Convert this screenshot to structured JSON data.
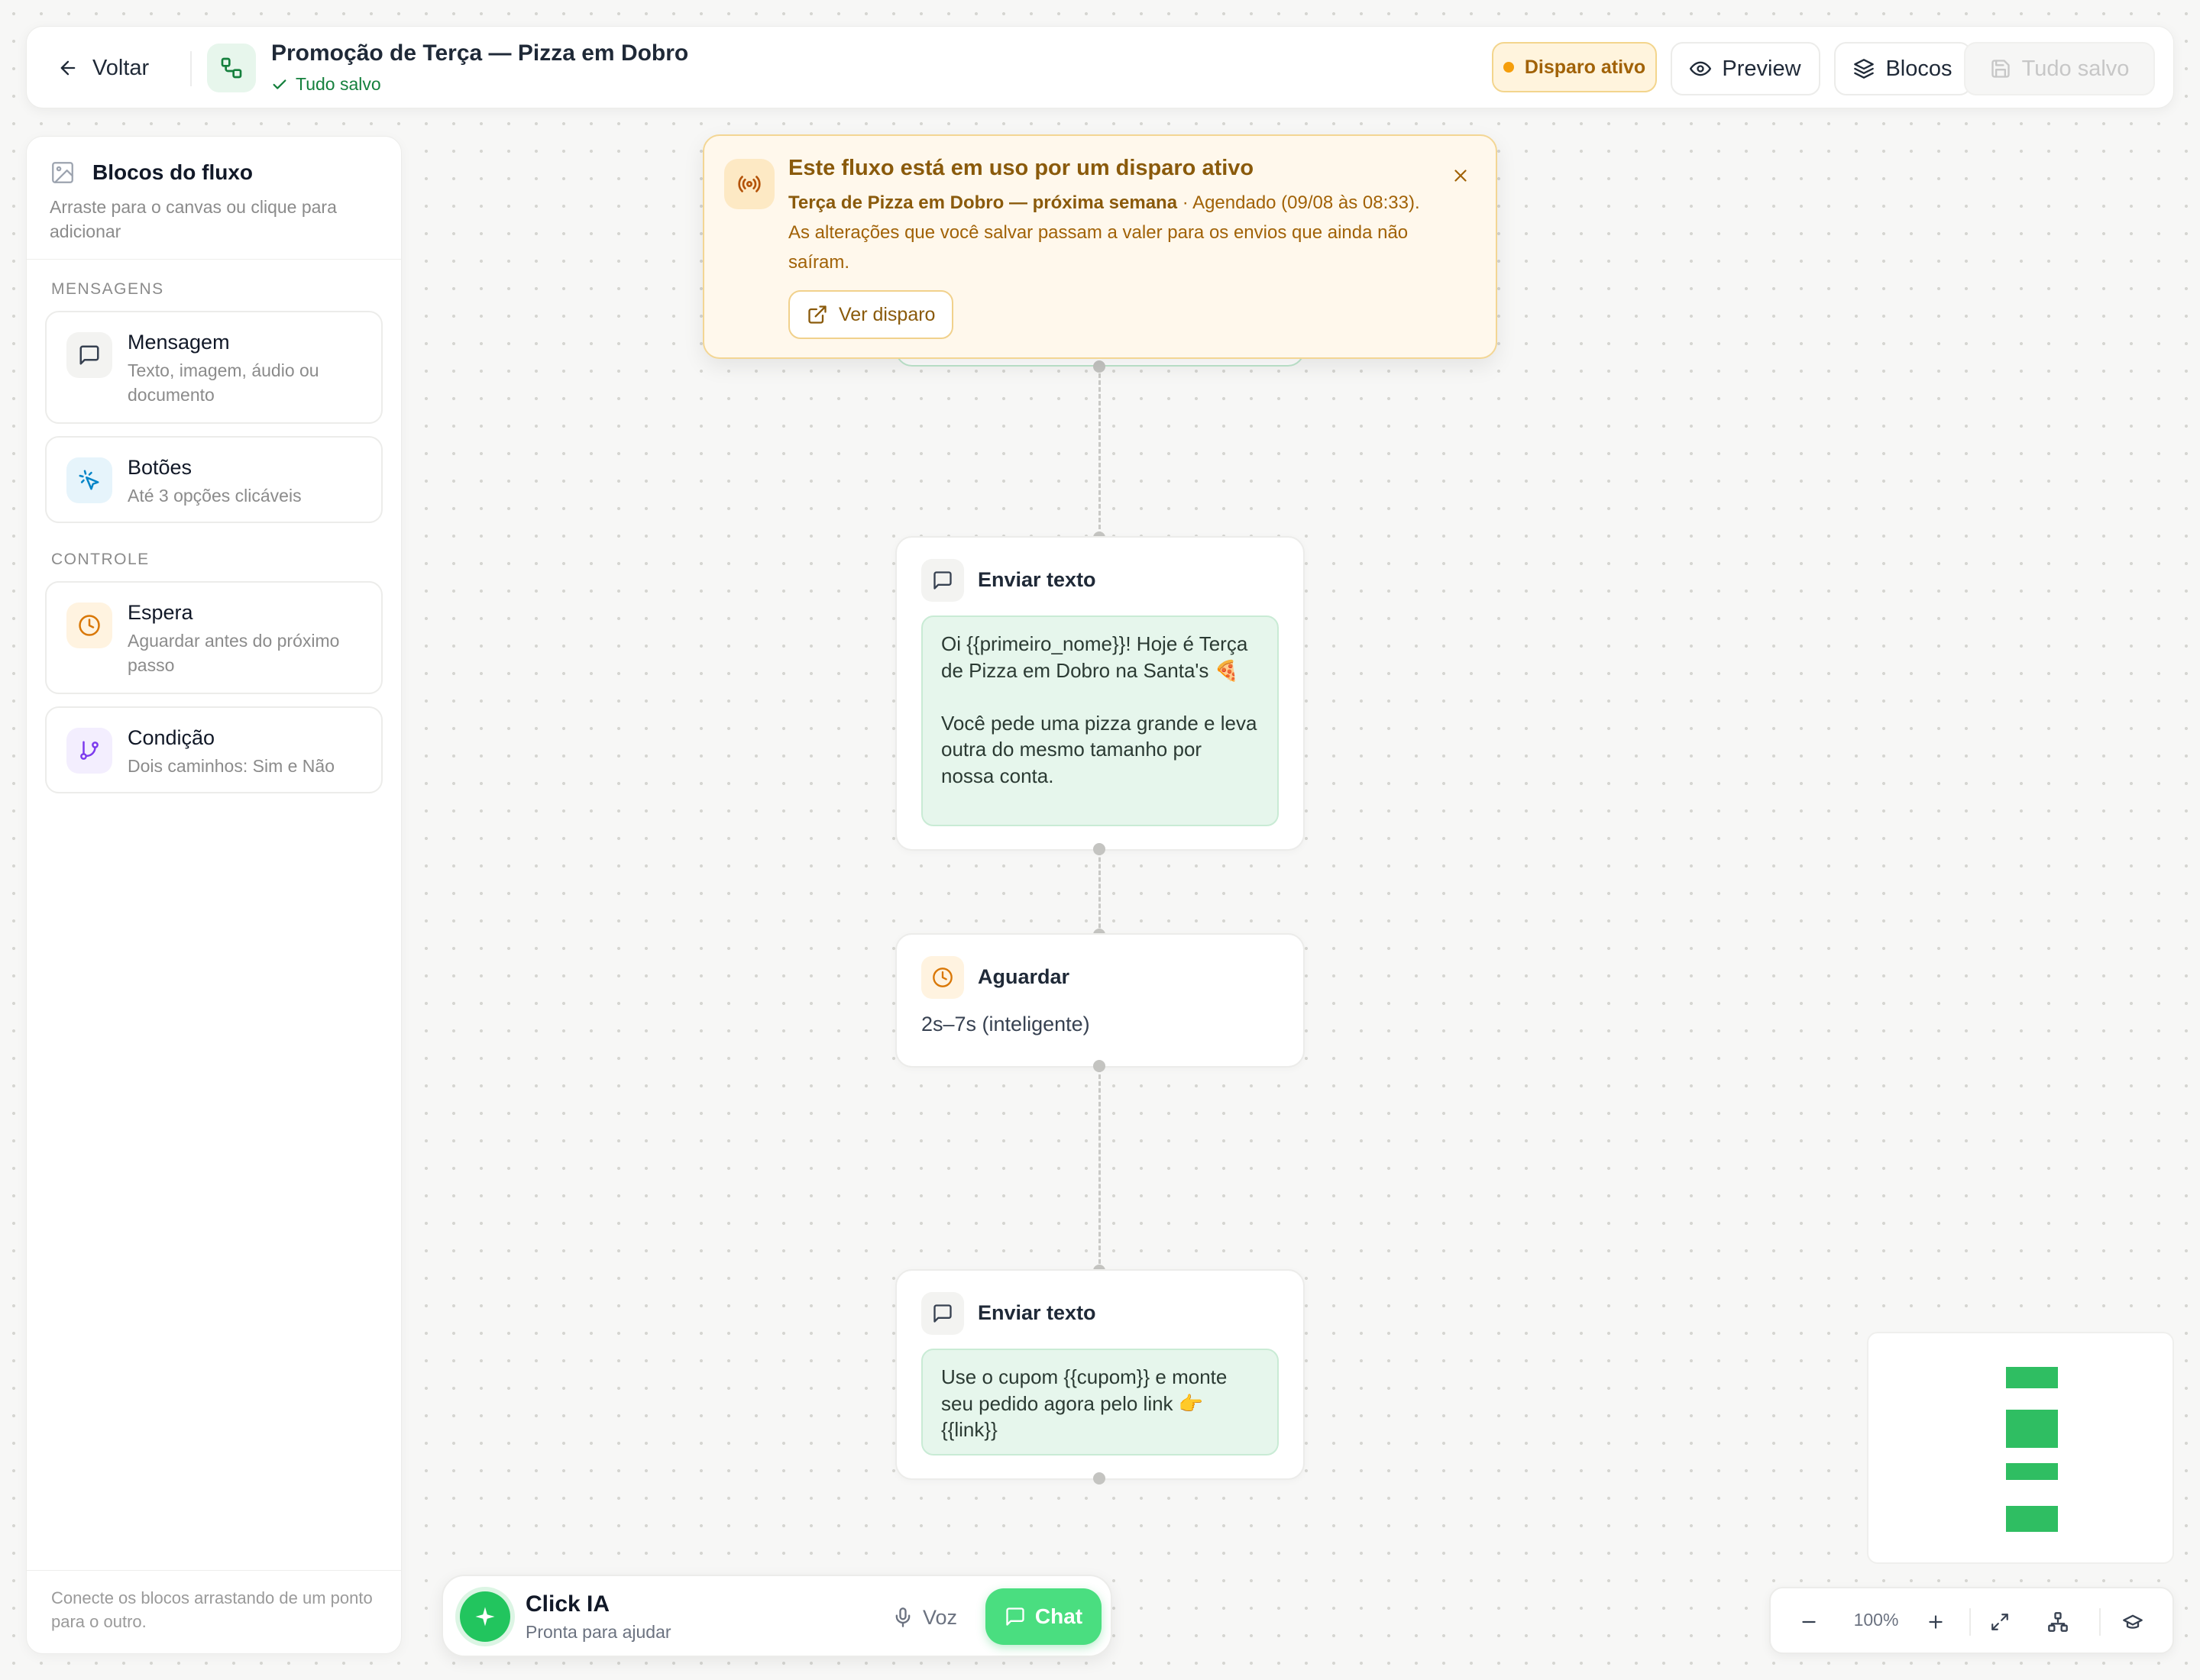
{
  "topbar": {
    "back_label": "Voltar",
    "flow_title": "Promoção de Terça — Pizza em Dobro",
    "save_status": "Tudo salvo",
    "disparo_badge": "Disparo ativo",
    "preview_label": "Preview",
    "blocos_label": "Blocos",
    "save_button_label": "Tudo salvo"
  },
  "sidebar": {
    "title": "Blocos do fluxo",
    "subtitle": "Arraste para o canvas ou clique para adicionar",
    "sections": [
      {
        "label": "MENSAGENS",
        "items": [
          {
            "title": "Mensagem",
            "desc": "Texto, imagem, áudio ou documento",
            "icon": "message-square-icon"
          },
          {
            "title": "Botões",
            "desc": "Até 3 opções clicáveis",
            "icon": "pointer-click-icon"
          }
        ]
      },
      {
        "label": "CONTROLE",
        "items": [
          {
            "title": "Espera",
            "desc": "Aguardar antes do próximo passo",
            "icon": "clock-icon"
          },
          {
            "title": "Condição",
            "desc": "Dois caminhos: Sim e Não",
            "icon": "git-branch-icon"
          }
        ]
      }
    ],
    "footer": "Conecte os blocos arrastando de um ponto para o outro."
  },
  "banner": {
    "title": "Este fluxo está em uso por um disparo ativo",
    "campaign_name": "Terça de Pizza em Dobro — próxima semana",
    "schedule_text": " · Agendado (09/08 às 08:33). As alterações que você salvar passam a valer para os envios que ainda não saíram.",
    "button_label": "Ver disparo"
  },
  "nodes": [
    {
      "type": "text",
      "title": "Enviar texto",
      "content": "Oi {{primeiro_nome}}! Hoje é Terça de Pizza em Dobro na Santa's 🍕\n\nVocê pede uma pizza grande e leva outra do mesmo tamanho por nossa conta."
    },
    {
      "type": "wait",
      "title": "Aguardar",
      "content": "2s–7s (inteligente)"
    },
    {
      "type": "text",
      "title": "Enviar texto",
      "content": "Use o cupom {{cupom}} e monte seu pedido agora pelo link 👉 {{link}}"
    }
  ],
  "assistant": {
    "name": "Click IA",
    "status": "Pronta para ajudar",
    "voice_label": "Voz",
    "chat_label": "Chat"
  },
  "zoom": {
    "level": "100%"
  },
  "colors": {
    "brand_green": "#22c55e",
    "warning_amber": "#f59e0b",
    "bubble_green": "#e6f6ec"
  }
}
